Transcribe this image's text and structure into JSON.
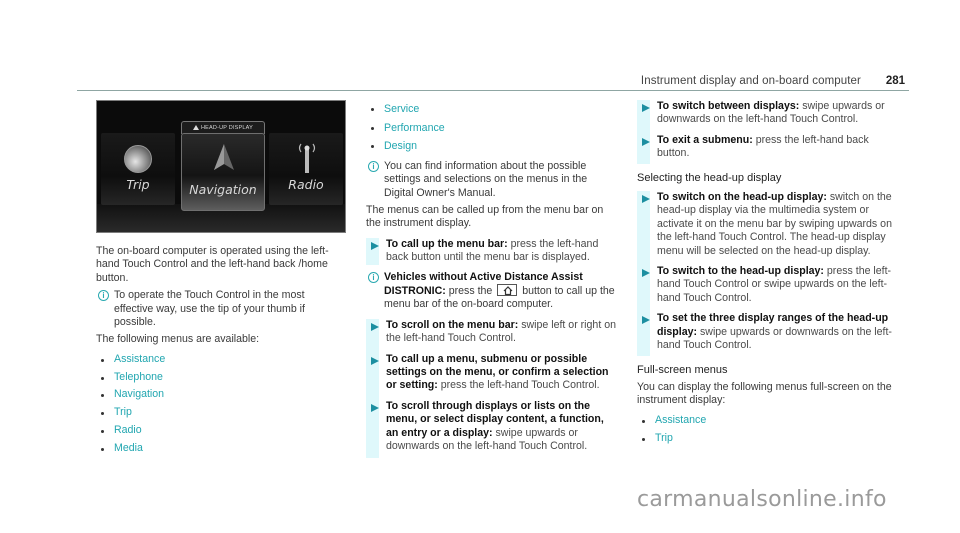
{
  "header": {
    "title": "Instrument display and on-board computer",
    "page_number": "281"
  },
  "figure": {
    "tab_label": "HEAD-UP DISPLAY",
    "tiles": [
      {
        "label": "Trip",
        "icon": "trip-dial-icon"
      },
      {
        "label": "Navigation",
        "icon": "navigation-arrow-icon"
      },
      {
        "label": "Radio",
        "icon": "radio-antenna-icon"
      }
    ]
  },
  "col1": {
    "intro": "The on-board computer is operated using the left-hand Touch Control and the left-hand back /home button.",
    "note": "To operate the Touch Control in the most effective way, use the tip of your thumb if possible.",
    "menus_intro": "The following menus are available:",
    "menus": [
      "Assistance",
      "Telephone",
      "Navigation",
      "Trip",
      "Radio",
      "Media"
    ]
  },
  "col2": {
    "menus": [
      "Service",
      "Performance",
      "Design"
    ],
    "note": "You can find information about the possible settings and selections on the menus in the Digital Owner's Manual.",
    "para": "The menus can be called up from the menu bar on the instrument display.",
    "step1": {
      "bold": "To call up the menu bar:",
      "body": " press the left-hand back button until the menu bar is displayed."
    },
    "note2": {
      "bold": "Vehicles without Active Distance Assist DISTRONIC:",
      "pre": " press the ",
      "post": " button to call up the menu bar of the on-board computer.",
      "button_icon": "home-icon"
    },
    "steps": [
      {
        "bold": "To scroll on the menu bar:",
        "body": " swipe left or right on the left-hand Touch Control."
      },
      {
        "bold": "To call up a menu, submenu or possible settings on the menu, or confirm a selection or setting:",
        "body": " press the left-hand Touch Control."
      },
      {
        "bold": "To scroll through displays or lists on the menu, or select display content, a function, an entry or a display:",
        "body": " swipe upwards or downwards on the left-hand Touch Control."
      }
    ]
  },
  "col3": {
    "steps_a": [
      {
        "bold": "To switch between displays:",
        "body": " swipe upwards or downwards on the left-hand Touch Control."
      },
      {
        "bold": "To exit a submenu:",
        "body": " press the left-hand back button."
      }
    ],
    "heading1": "Selecting the head-up display",
    "steps_b": [
      {
        "bold": "To switch on the head-up display:",
        "body": " switch on the head-up display via the multimedia system or activate it on the menu bar by swiping upwards on the left-hand Touch Control. The head-up display menu will be selected on the head-up display."
      },
      {
        "bold": "To switch to the head-up display:",
        "body": " press the left-hand Touch Control or swipe upwards on the left-hand Touch Control."
      },
      {
        "bold": "To set the three display ranges of the head-up display:",
        "body": " swipe upwards or downwards on the left-hand Touch Control."
      }
    ],
    "heading2": "Full-screen menus",
    "para": "You can display the following menus full-screen on the instrument display:",
    "menus": [
      "Assistance",
      "Trip"
    ]
  },
  "watermark": "carmanualsonline.info",
  "colors": {
    "link": "#21a6b0",
    "step_bar": "#dff8fb",
    "step_arrow": "#1c8fa1",
    "rule": "#8fa6a3"
  }
}
